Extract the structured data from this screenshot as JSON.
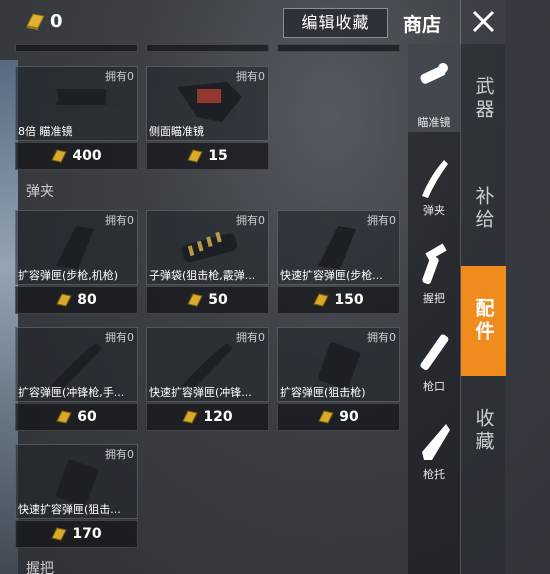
{
  "currency": {
    "amount": "0",
    "icon": "gold-bar-icon"
  },
  "header": {
    "edit_favorites": "编辑收藏",
    "shop_title": "商店"
  },
  "sections": {
    "scope_partial_prices": [
      "",
      "",
      ""
    ],
    "magazine_label": "弹夹",
    "grip_label": "握把"
  },
  "scope_items": [
    {
      "owned": "拥有0",
      "name": "8倍 瞄准镜",
      "price": "400"
    },
    {
      "owned": "拥有0",
      "name": "侧面瞄准镜",
      "price": "15"
    }
  ],
  "magazine_items": [
    {
      "owned": "拥有0",
      "name": "扩容弹匣(步枪,机枪)",
      "price": "80"
    },
    {
      "owned": "拥有0",
      "name": "子弹袋(狙击枪,霰弹...",
      "price": "50"
    },
    {
      "owned": "拥有0",
      "name": "快速扩容弹匣(步枪...",
      "price": "150"
    },
    {
      "owned": "拥有0",
      "name": "扩容弹匣(冲锋枪,手...",
      "price": "60"
    },
    {
      "owned": "拥有0",
      "name": "快速扩容弹匣(冲锋...",
      "price": "120"
    },
    {
      "owned": "拥有0",
      "name": "扩容弹匣(狙击枪)",
      "price": "90"
    },
    {
      "owned": "拥有0",
      "name": "快速扩容弹匣(狙击...",
      "price": "170"
    }
  ],
  "subnav": [
    {
      "label": "瞄准镜",
      "icon": "scope-icon",
      "active": true
    },
    {
      "label": "弹夹",
      "icon": "magazine-icon",
      "active": false
    },
    {
      "label": "握把",
      "icon": "grip-icon",
      "active": false
    },
    {
      "label": "枪口",
      "icon": "muzzle-icon",
      "active": false
    },
    {
      "label": "枪托",
      "icon": "stock-icon",
      "active": false
    }
  ],
  "mainnav": [
    {
      "label": "武器",
      "active": false
    },
    {
      "label": "补给",
      "active": false
    },
    {
      "label": "配件",
      "active": true
    },
    {
      "label": "收藏",
      "active": false
    }
  ],
  "colors": {
    "accent": "#f08c1e",
    "gold": "#d9a929"
  }
}
